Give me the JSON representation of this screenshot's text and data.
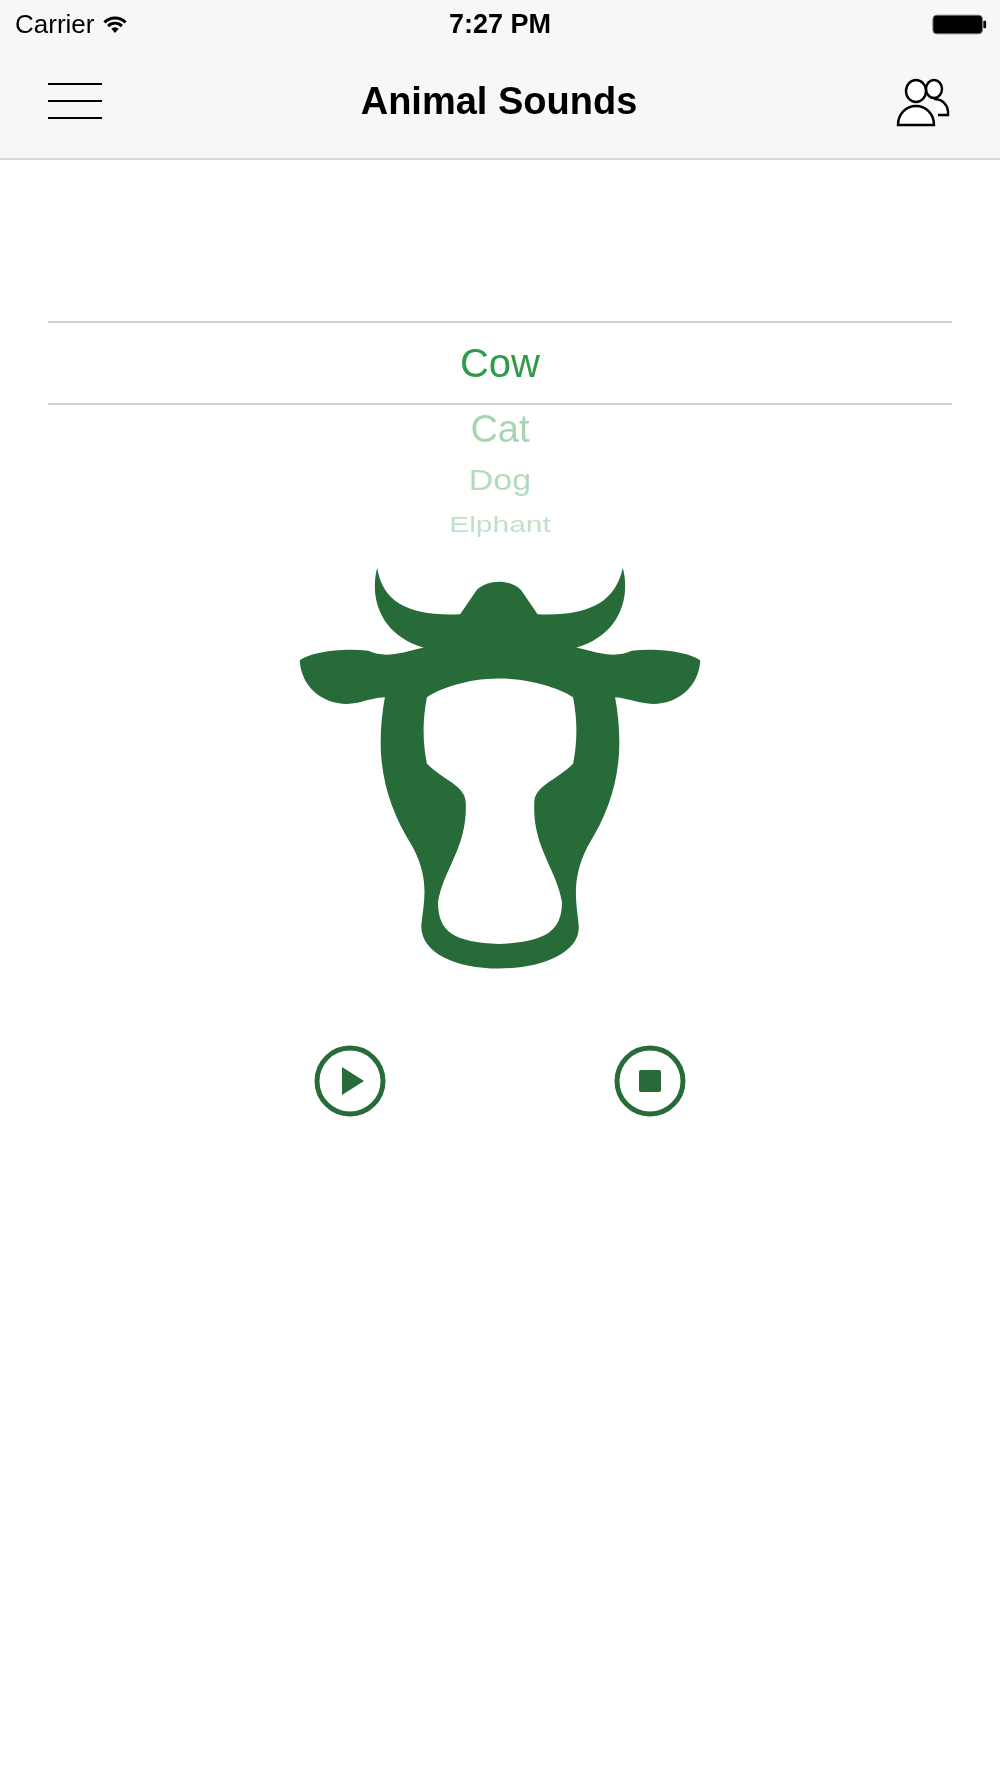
{
  "status_bar": {
    "carrier": "Carrier",
    "time": "7:27 PM"
  },
  "nav_bar": {
    "title": "Animal Sounds"
  },
  "picker": {
    "items": [
      {
        "label": "Cow",
        "selected": true
      },
      {
        "label": "Cat",
        "selected": false
      },
      {
        "label": "Dog",
        "selected": false
      },
      {
        "label": "Elphant",
        "selected": false
      }
    ]
  },
  "controls": [
    {
      "kind": "play"
    },
    {
      "kind": "stop"
    }
  ]
}
